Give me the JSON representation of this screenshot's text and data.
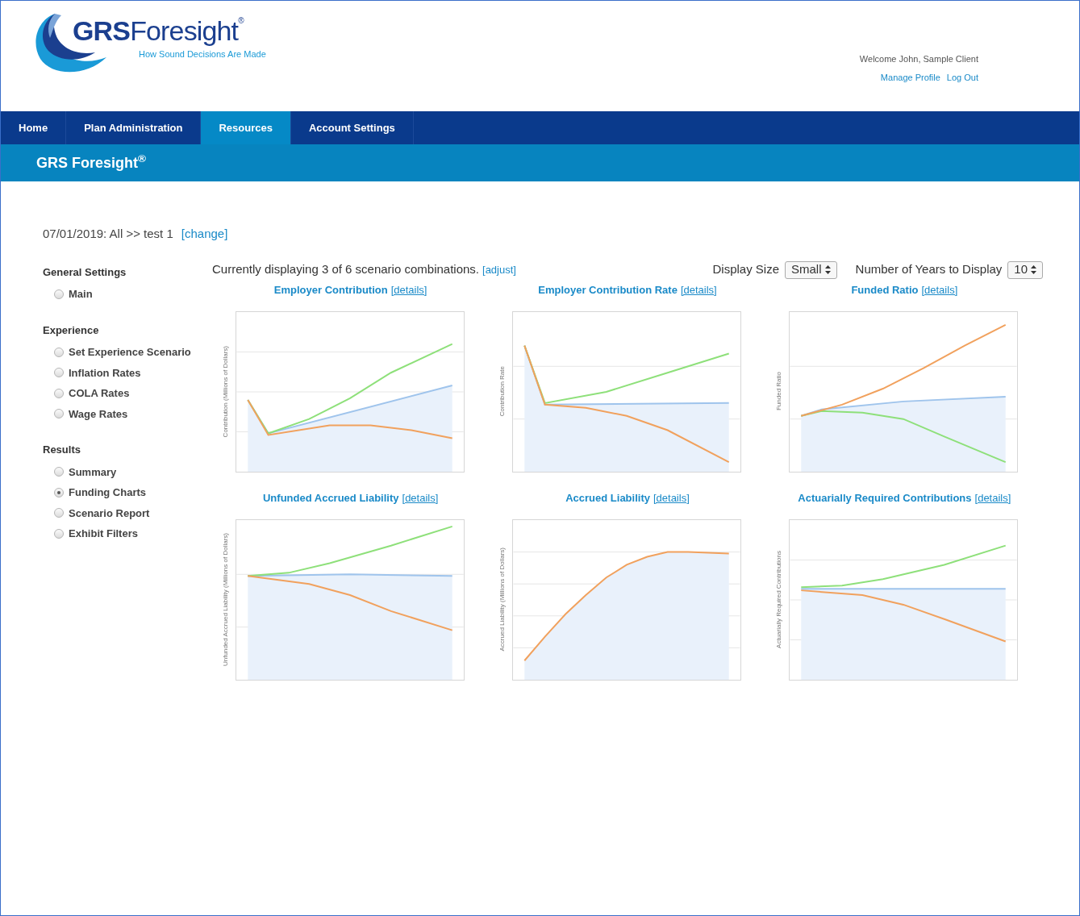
{
  "header": {
    "logo": {
      "brand_bold": "GRS",
      "brand": "Foresight",
      "mark": "®",
      "tagline": "How Sound Decisions Are Made"
    },
    "welcome": "Welcome John, Sample Client",
    "links": [
      "Manage Profile",
      "Log Out"
    ]
  },
  "nav": {
    "tabs": [
      {
        "label": "Home",
        "selected": false
      },
      {
        "label": "Plan Administration",
        "selected": false
      },
      {
        "label": "Resources",
        "selected": true
      },
      {
        "label": "Account Settings",
        "selected": false
      }
    ]
  },
  "banner": {
    "title": "GRS Foresight$^{®}$"
  },
  "breadcrumb": {
    "text": "07/01/2019: All >> test 1",
    "link": "[change]"
  },
  "sidebar": {
    "groups": [
      {
        "title": "General Settings",
        "items": [
          {
            "label": "Main",
            "selected": false
          }
        ]
      },
      {
        "title": "Experience",
        "items": [
          {
            "label": "Set Experience Scenario",
            "selected": false
          },
          {
            "label": "Inflation Rates",
            "selected": false
          },
          {
            "label": "COLA Rates",
            "selected": false
          },
          {
            "label": "Wage Rates",
            "selected": false
          }
        ]
      },
      {
        "title": "Results",
        "items": [
          {
            "label": "Summary",
            "selected": false
          },
          {
            "label": "Funding Charts",
            "selected": true
          },
          {
            "label": "Scenario Report",
            "selected": false
          },
          {
            "label": "Exhibit Filters",
            "selected": false
          }
        ]
      }
    ]
  },
  "toolbar": {
    "summary": "Currently displaying 3 of 6 scenario combinations.",
    "adjust_link": "[adjust]",
    "display_size": {
      "label": "Display Size",
      "value": "Small"
    },
    "years": {
      "label": "Number of Years to Display",
      "value": "10"
    }
  },
  "charts": [
    {
      "title": "Employer Contribution",
      "link": "[details]",
      "ylabel": "Contribution (Millions of Dollars)"
    },
    {
      "title": "Employer Contribution Rate",
      "link": "[details]",
      "ylabel": "Contribution Rate"
    },
    {
      "title": "Funded Ratio",
      "link": "[details]",
      "ylabel": "Funded Ratio"
    },
    {
      "title": "Unfunded Accrued Liability",
      "link": "[details]",
      "ylabel": "Unfunded Accrued Liability (Millions of Dollars)"
    },
    {
      "title": "Accrued Liability",
      "link": "[details]",
      "ylabel": "Accrued Liability (Millions of Dollars)"
    },
    {
      "title": "Actuarially Required Contributions",
      "link": "[details]",
      "ylabel": "Actuarially Required Contributions"
    }
  ]
}
